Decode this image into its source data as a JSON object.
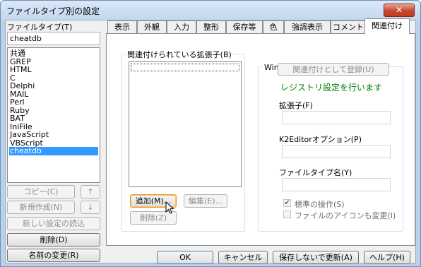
{
  "window": {
    "title": "ファイルタイプ別の設定",
    "close_glyph": "✕"
  },
  "left": {
    "filetype_label": "ファイルタイプ(T)",
    "filetype_value": "cheatdb",
    "list_items": [
      "共通",
      "GREP",
      "HTML",
      "C",
      "Delphi",
      "MAIL",
      "Perl",
      "Ruby",
      "BAT",
      "IniFile",
      "JavaScript",
      "VBScript",
      "cheatdb"
    ],
    "selected_item": "cheatdb",
    "copy_button": "コピー(C)",
    "up_arrow": "↑",
    "new_button": "新規作成(N)",
    "down_arrow": "↓",
    "load_new_button": "新しい設定の読込",
    "delete_button": "削除(D)",
    "rename_button": "名前の変更(R)"
  },
  "tabs": [
    "表示",
    "外観",
    "入力",
    "整形",
    "保存等",
    "色",
    "強調表示",
    "コメント",
    "関連付け"
  ],
  "active_tab": "関連付け",
  "assoc": {
    "ext_group_title": "関連付けられている拡張子(B)",
    "add_button": "追加(M)...",
    "edit_button": "編集(E)...",
    "remove_button": "削除(Z)",
    "win_group_title": "Windowsへの関連付け",
    "register_button": "関連付けとして登録(U)",
    "registry_message": "レジストリ設定を行います",
    "extension_label": "拡張子(F)",
    "k2_option_label": "K2Editorオプション(P)",
    "filetype_name_label": "ファイルタイプ名(Y)",
    "standard_action_label": "標準の操作(S)",
    "standard_action_checked": true,
    "icon_change_label": "ファイルのアイコンも変更(I)",
    "icon_change_checked": false
  },
  "footer": {
    "ok": "OK",
    "cancel": "キャンセル",
    "update_no_save": "保存しないで更新(A)",
    "help": "ヘルプ(H)"
  },
  "colors": {
    "selection": "#3399ff",
    "message_green": "#008000",
    "focus_orange": "#e59734"
  }
}
